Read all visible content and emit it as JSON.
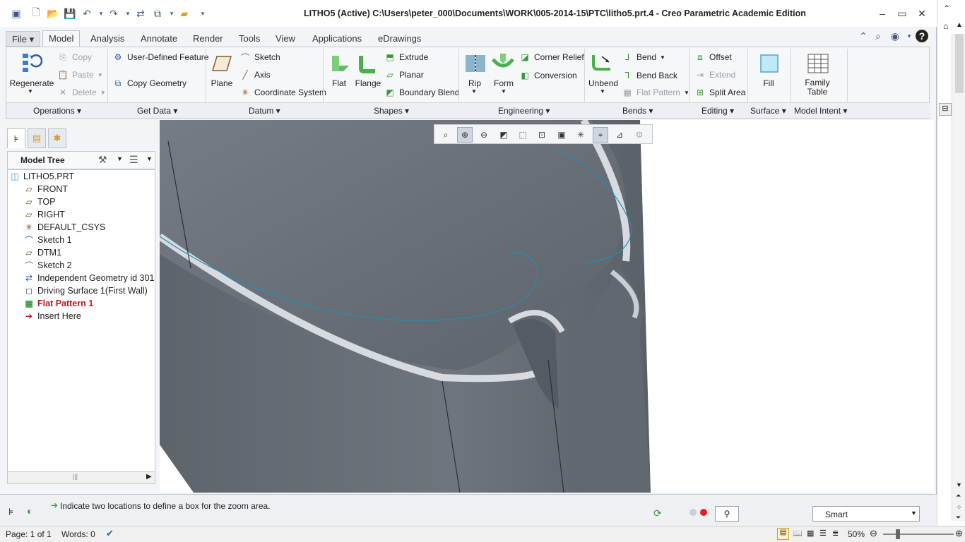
{
  "window": {
    "title": "LITHO5 (Active) C:\\Users\\peter_000\\Documents\\WORK\\005-2014-15\\PTC\\litho5.prt.4 - Creo Parametric Academic Edition"
  },
  "tabs": [
    "File",
    "Model",
    "Analysis",
    "Annotate",
    "Render",
    "Tools",
    "View",
    "Applications",
    "eDrawings"
  ],
  "ribbon": {
    "operations": {
      "regenerate": "Regenerate",
      "copy": "Copy",
      "paste": "Paste",
      "delete": "Delete",
      "group": "Operations"
    },
    "get_data": {
      "udf": "User-Defined Feature",
      "copy_geometry": "Copy Geometry",
      "group": "Get Data"
    },
    "datum": {
      "plane": "Plane",
      "sketch": "Sketch",
      "axis": "Axis",
      "csys": "Coordinate System",
      "group": "Datum"
    },
    "shapes": {
      "flat": "Flat",
      "flange": "Flange",
      "extrude": "Extrude",
      "planar": "Planar",
      "boundary_blend": "Boundary Blend",
      "group": "Shapes"
    },
    "engineering": {
      "rip": "Rip",
      "form": "Form",
      "corner_relief": "Corner Relief",
      "conversion": "Conversion",
      "group": "Engineering"
    },
    "bends": {
      "unbend": "Unbend",
      "bend": "Bend",
      "bend_back": "Bend Back",
      "flat_pattern": "Flat Pattern",
      "group": "Bends"
    },
    "editing": {
      "offset": "Offset",
      "extend": "Extend",
      "split_area": "Split Area",
      "group": "Editing"
    },
    "surface": {
      "fill": "Fill",
      "group": "Surface"
    },
    "model_intent": {
      "family_table_1": "Family",
      "family_table_2": "Table",
      "group": "Model Intent"
    }
  },
  "tree": {
    "header": "Model Tree",
    "nodes": [
      {
        "label": "LITHO5.PRT",
        "icon": "part-icon"
      },
      {
        "label": "FRONT",
        "icon": "datum-plane-icon"
      },
      {
        "label": "TOP",
        "icon": "datum-plane-icon"
      },
      {
        "label": "RIGHT",
        "icon": "datum-plane-icon"
      },
      {
        "label": "DEFAULT_CSYS",
        "icon": "csys-icon"
      },
      {
        "label": "Sketch 1",
        "icon": "sketch-icon"
      },
      {
        "label": "DTM1",
        "icon": "datum-plane-icon"
      },
      {
        "label": "Sketch 2",
        "icon": "sketch-icon"
      },
      {
        "label": "Independent Geometry id 301",
        "icon": "geometry-icon"
      },
      {
        "label": "Driving Surface 1(First Wall)",
        "icon": "wall-icon"
      },
      {
        "label": "Flat Pattern 1",
        "icon": "flat-pattern-icon"
      },
      {
        "label": "Insert Here",
        "icon": "insert-arrow-icon"
      }
    ]
  },
  "status": {
    "message": "Indicate two locations to define a box for the zoom area.",
    "filter": "Smart"
  },
  "wordbar": {
    "page": "Page: 1 of 1",
    "words": "Words: 0",
    "zoom": "50%"
  },
  "colors": {
    "accent": "#2a5da8",
    "model_dark": "#646b73",
    "model_light": "#a9b0b8",
    "edge": "#d7dbe0",
    "curve": "#1f8fb6",
    "selected_text": "#c0191f"
  }
}
